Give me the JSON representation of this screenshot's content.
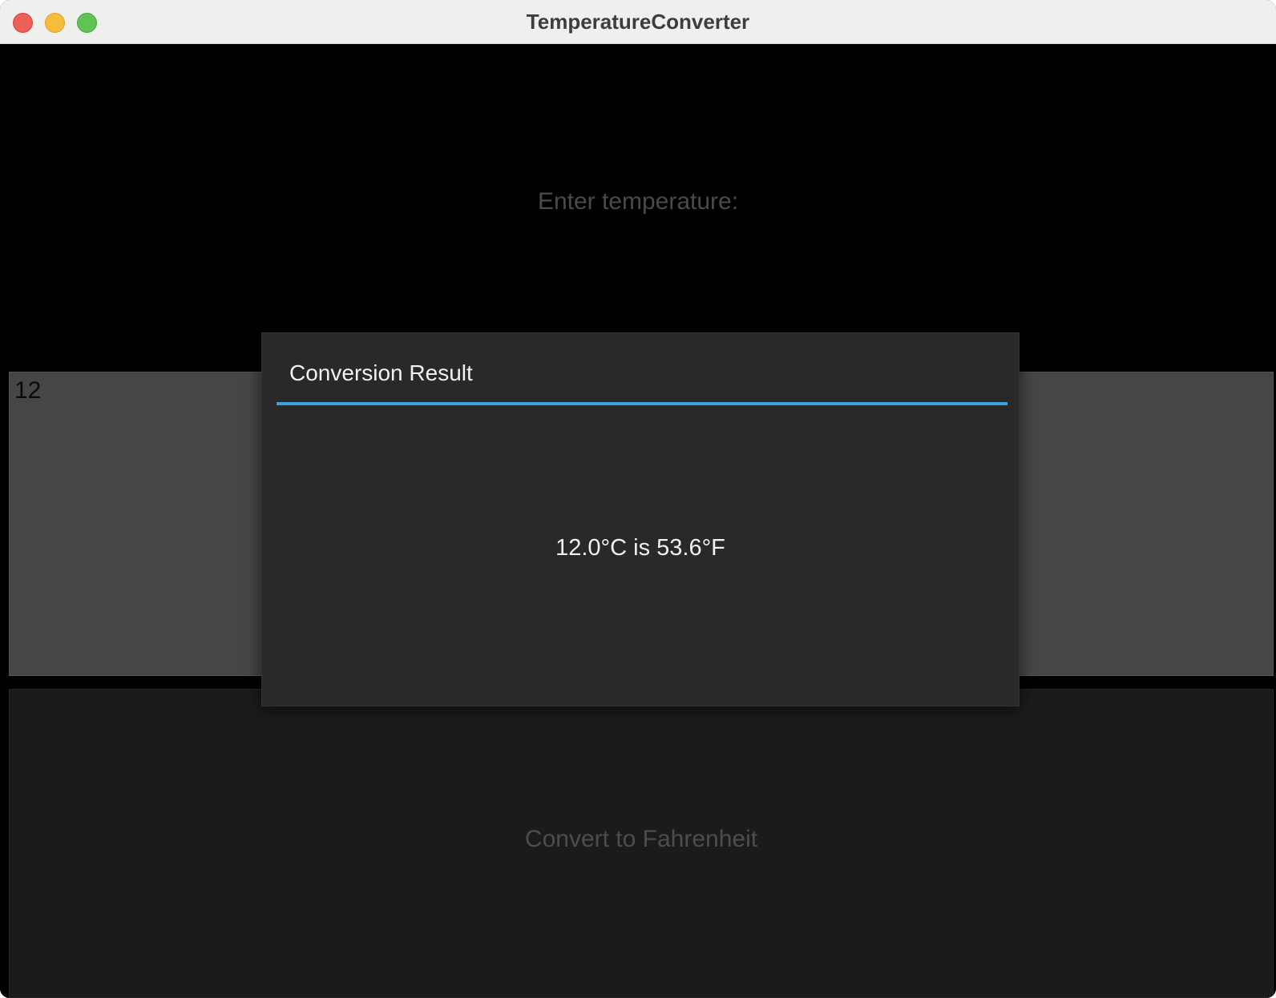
{
  "window": {
    "title": "TemperatureConverter"
  },
  "main": {
    "prompt_label": "Enter temperature:",
    "temperature_input": {
      "value": "12"
    },
    "convert_button_label": "Convert to Fahrenheit"
  },
  "dialog": {
    "title": "Conversion Result",
    "message": "12.0°C is 53.6°F",
    "accent_color": "#3aa3dc"
  }
}
